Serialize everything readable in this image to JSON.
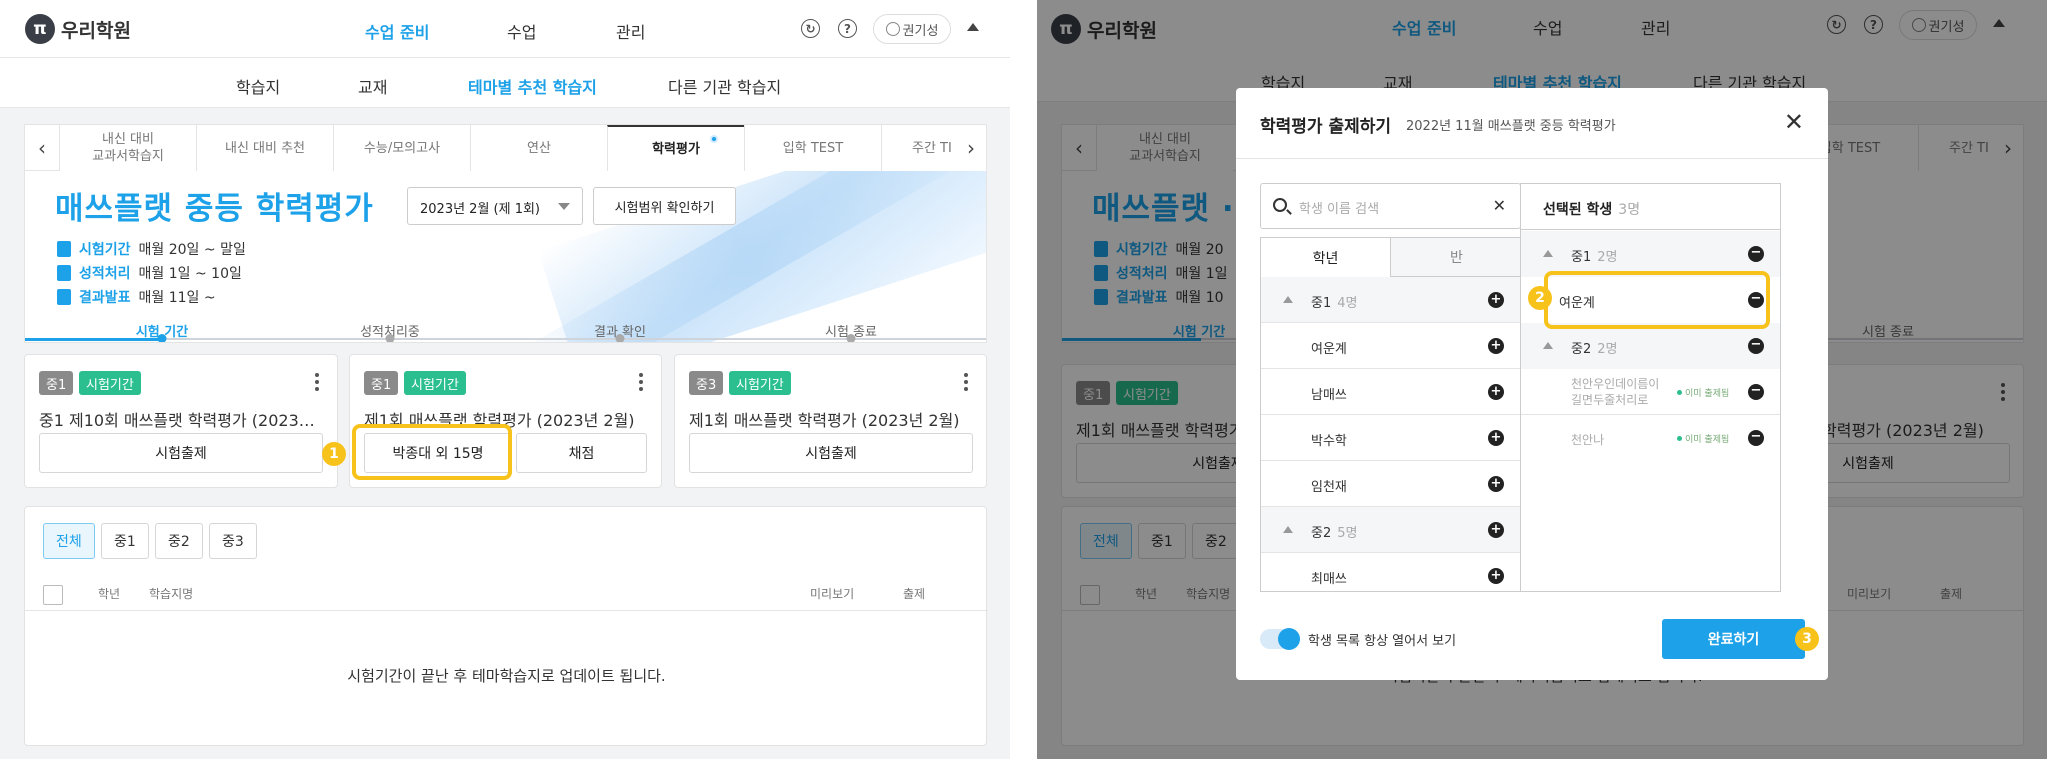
{
  "header": {
    "logo_mark": "π",
    "logo_text": "우리학원",
    "nav": [
      "수업 준비",
      "수업",
      "관리"
    ],
    "refresh_icon": "refresh-icon",
    "help_icon": "help-icon",
    "user_name": "권기성"
  },
  "subnav": [
    "학습지",
    "교재",
    "테마별 추천 학습지",
    "다른 기관 학습지"
  ],
  "tabs": [
    "내신 대비\n교과서학습지",
    "내신 대비 추천",
    "수능/모의고사",
    "연산",
    "학력평가",
    "입학 TEST",
    "주간 TI"
  ],
  "right_tabs": [
    "내신 대비\n교과서학습지",
    "입학 TEST",
    "주간 TI"
  ],
  "hero": {
    "title": "매쓰플랫 중등 학력평가",
    "right_title": "매쓰플랫 ·",
    "select_value": "2023년 2월 (제 1회)",
    "range_button": "시험범위 확인하기",
    "info": [
      {
        "label": "시험기간",
        "value": "매월 20일 ~ 말일"
      },
      {
        "label": "성적처리",
        "value": "매월 1일 ~ 10일"
      },
      {
        "label": "결과발표",
        "value": "매월 11일 ~"
      }
    ],
    "right_info_values": [
      "매월 20",
      "매월 1일",
      "매월 10"
    ],
    "steps": [
      "시험 기간",
      "성적처리중",
      "결과 확인",
      "시험 종료"
    ],
    "current_step_index": 0
  },
  "cards": [
    {
      "grade": "중1",
      "status": "시험기간",
      "title": "중1 제10회 매쓰플랫 학력평가 (2023년 2...",
      "buttons": [
        "시험출제"
      ]
    },
    {
      "grade": "중1",
      "status": "시험기간",
      "title": "제1회 매쓰플랫 학력평가 (2023년 2월)",
      "buttons": [
        "박종대 외 15명",
        "채점"
      ]
    },
    {
      "grade": "중3",
      "status": "시험기간",
      "title": "제1회 매쓰플랫 학력평가 (2023년 2월)",
      "buttons": [
        "시험출제"
      ]
    }
  ],
  "right_cards": [
    {
      "title": "제1회 매쓰플랫 학력평가",
      "button": "시험출제"
    },
    {
      "title": "학력평가 (2023년 2월)",
      "button": "시험출제"
    }
  ],
  "list": {
    "filters": [
      "전체",
      "중1",
      "중2",
      "중3"
    ],
    "columns": [
      "학년",
      "학습지명",
      "미리보기",
      "출제"
    ],
    "empty_message": "시험기간이 끝난 후 테마학습지로 업데이트 됩니다.",
    "right_empty_message": "시험기간이 끝난 후 테마학습지로 업데이트 됩니다."
  },
  "modal": {
    "title": "학력평가 출제하기",
    "subtitle": "2022년 11월 매쓰플랫 중등 학력평가",
    "search_placeholder": "학생 이름 검색",
    "tabs": [
      "학년",
      "반"
    ],
    "left_rows": [
      {
        "type": "group",
        "name": "중1",
        "count": "4명",
        "action": "+"
      },
      {
        "type": "student",
        "name": "여운계",
        "action": "+"
      },
      {
        "type": "student",
        "name": "남매쓰",
        "action": "+"
      },
      {
        "type": "student",
        "name": "박수학",
        "action": "+"
      },
      {
        "type": "student",
        "name": "임천재",
        "action": "+"
      },
      {
        "type": "group",
        "name": "중2",
        "count": "5명",
        "action": "+"
      },
      {
        "type": "student",
        "name": "최매쓰",
        "action": "+"
      }
    ],
    "selected_title": "선택된 학생",
    "selected_count": "3명",
    "selected_rows": [
      {
        "type": "group",
        "name": "중1",
        "count": "2명"
      },
      {
        "type": "student",
        "name": "여운계"
      },
      {
        "type": "group",
        "name": "중2",
        "count": "2명"
      },
      {
        "type": "student",
        "name": "천안우인데이름이\n길면두줄처리로",
        "note": "이미 출제됨"
      },
      {
        "type": "student",
        "name": "천안나",
        "note": "이미 출제됨"
      }
    ],
    "toggle_label": "학생 목록 항상 열어서 보기",
    "toggle_on": true,
    "done_button": "완료하기"
  },
  "markers": [
    "1",
    "2",
    "3"
  ],
  "colors": {
    "accent": "#1da1e8",
    "highlight": "#f7c21a",
    "badge_green": "#2bbf8f",
    "badge_gray": "#8a8a8a"
  }
}
